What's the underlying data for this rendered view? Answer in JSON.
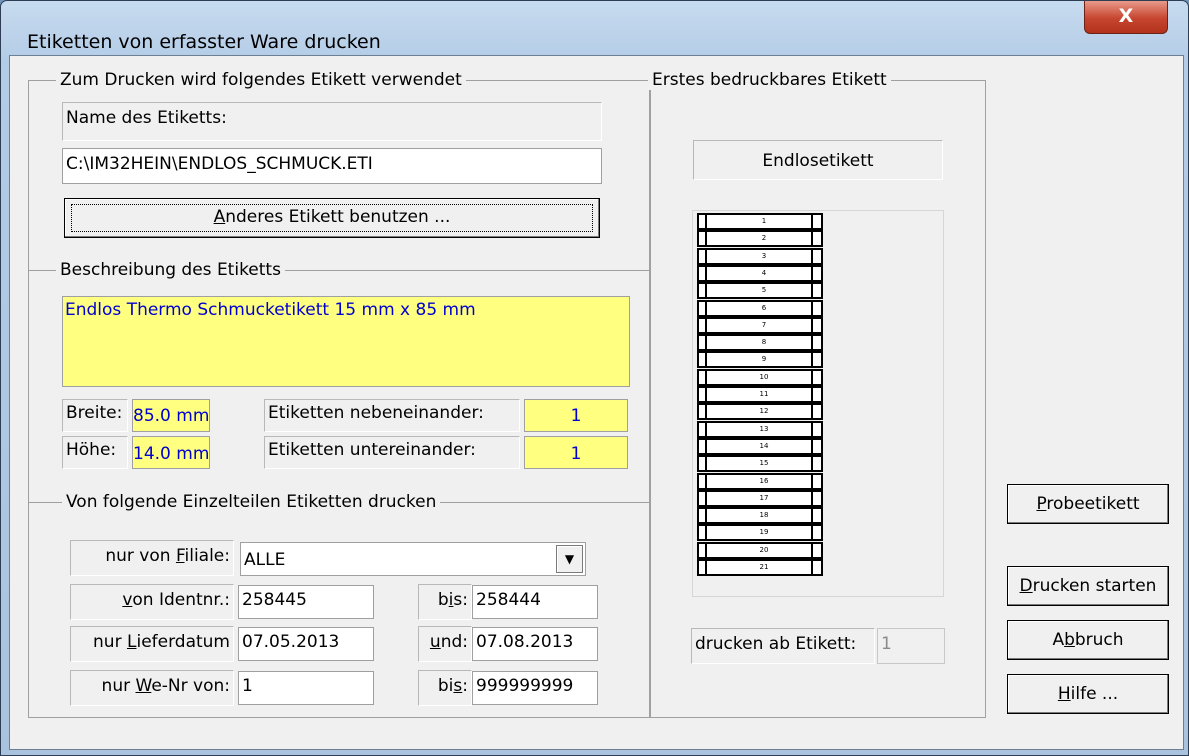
{
  "window": {
    "title": "Etiketten von erfasster Ware drucken",
    "close_label": "X"
  },
  "label_group": {
    "legend": "Zum Drucken wird folgendes Etikett verwendet",
    "name_label": "Name des Etiketts:",
    "name_value": "C:\\IM32HEIN\\ENDLOS_SCHMUCK.ETI",
    "change_button": {
      "prefix": "",
      "hotkey": "A",
      "suffix": "nderes Etikett benutzen ..."
    }
  },
  "description_group": {
    "legend": "Beschreibung des Etiketts",
    "text": "Endlos Thermo Schmucketikett 15 mm x 85 mm",
    "width_label": "Breite:",
    "width_value": "85.0 mm",
    "height_label": "Höhe:",
    "height_value": "14.0 mm",
    "side_by_side_label": "Etiketten nebeneinander:",
    "side_by_side_value": "1",
    "stacked_label": "Etiketten untereinander:",
    "stacked_value": "1"
  },
  "filter_group": {
    "legend": "Von folgende Einzelteilen Etiketten drucken",
    "branch": {
      "prefix": "nur von ",
      "hotkey": "F",
      "suffix": "iliale:",
      "value": "ALLE"
    },
    "ident": {
      "prefix": "",
      "hotkey": "v",
      "suffix": "on Identnr.:",
      "from": "258445",
      "to_prefix": "b",
      "to_hotkey": "i",
      "to_suffix": "s:",
      "to": "258444"
    },
    "delivery": {
      "prefix": "nur ",
      "hotkey": "L",
      "suffix": "ieferdatum",
      "from": "07.05.2013",
      "to_prefix": "",
      "to_hotkey": "u",
      "to_suffix": "nd:",
      "to": "07.08.2013"
    },
    "we": {
      "prefix": "nur ",
      "hotkey": "W",
      "suffix": "e-Nr von:",
      "from": "1",
      "to_prefix": "bi",
      "to_hotkey": "s",
      "to_suffix": ":",
      "to": "999999999"
    }
  },
  "preview_group": {
    "legend": "Erstes bedruckbares Etikett",
    "type_label": "Endlosetikett",
    "strip_numbers": [
      "1",
      "2",
      "3",
      "4",
      "5",
      "6",
      "7",
      "8",
      "9",
      "10",
      "11",
      "12",
      "13",
      "14",
      "15",
      "16",
      "17",
      "18",
      "19",
      "20",
      "21"
    ],
    "start_label": "drucken ab Etikett:",
    "start_value": "1"
  },
  "buttons": {
    "sample": {
      "prefix": "",
      "hotkey": "P",
      "suffix": "robeetikett"
    },
    "start": {
      "prefix": "",
      "hotkey": "D",
      "suffix": "rucken starten"
    },
    "cancel": {
      "prefix": "A",
      "hotkey": "b",
      "suffix": "bruch"
    },
    "help": {
      "prefix": "",
      "hotkey": "H",
      "suffix": "ilfe ..."
    }
  }
}
